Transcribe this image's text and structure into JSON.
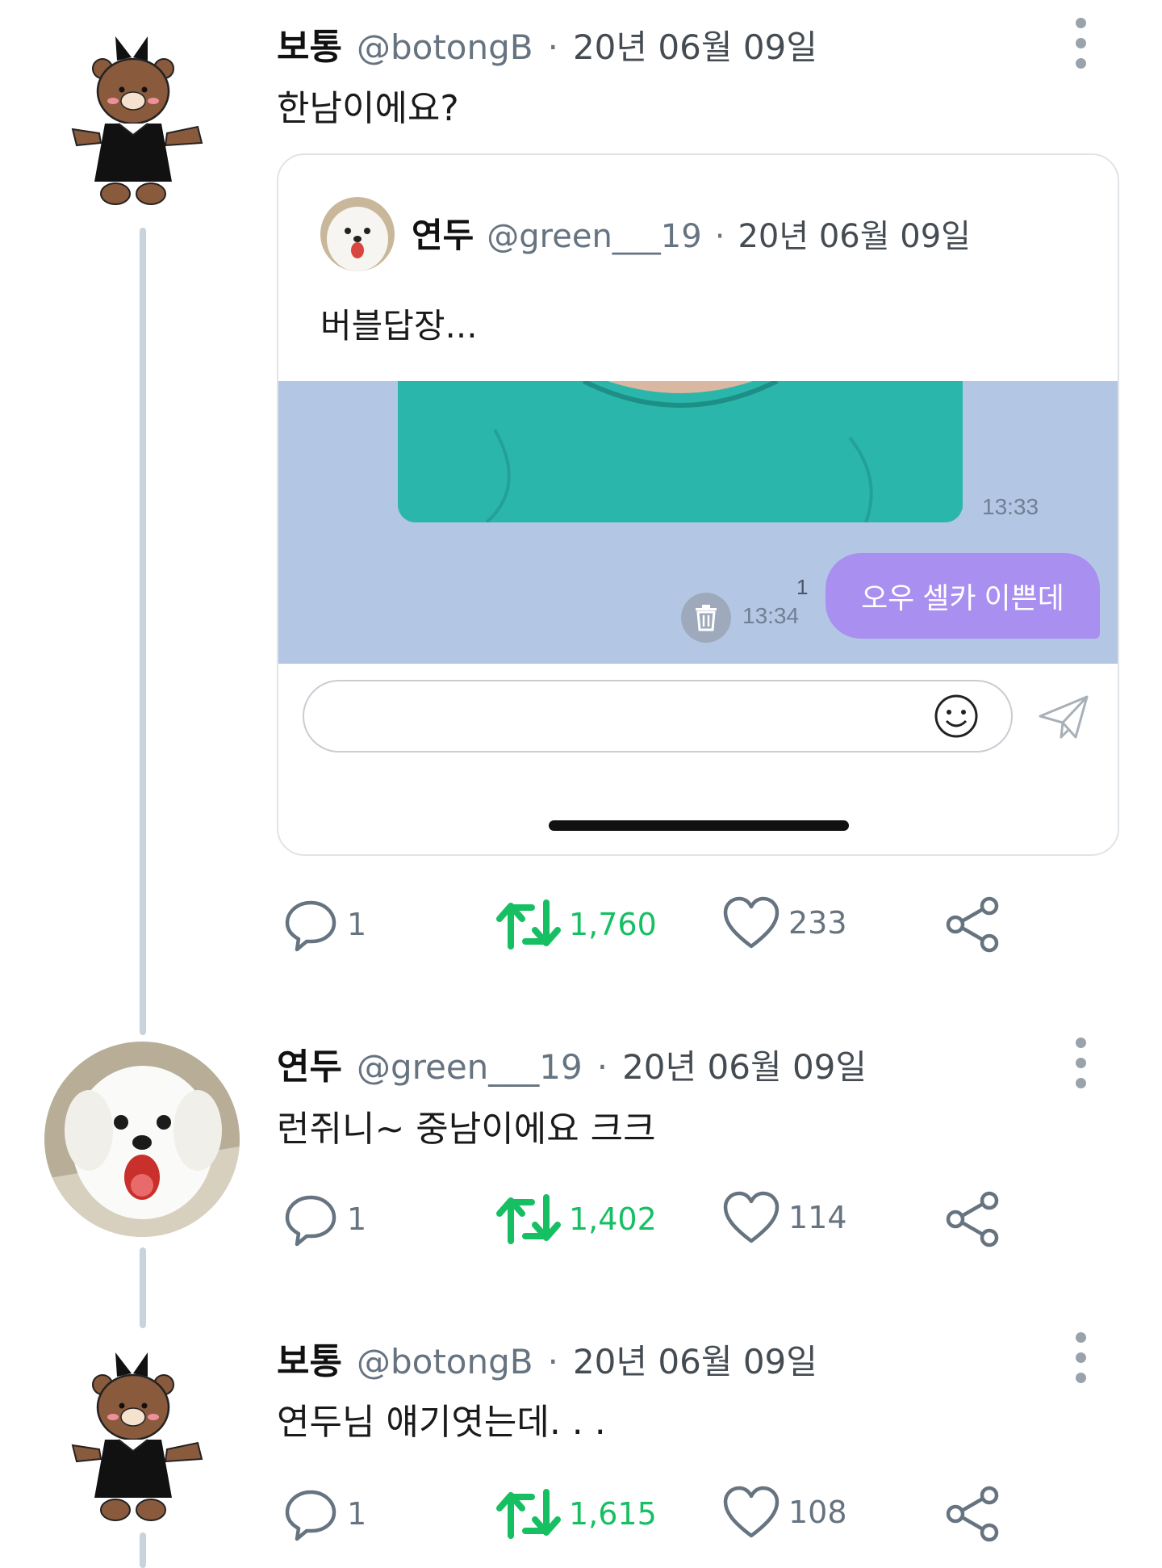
{
  "tweets": [
    {
      "name": "보통",
      "handle": "@botongB",
      "dot": "·",
      "date": "20년 06월 09일",
      "text": "한남이에요?",
      "replies": "1",
      "retweets": "1,760",
      "likes": "233"
    },
    {
      "name": "연두",
      "handle": "@green___19",
      "dot": "·",
      "date": "20년 06월 09일",
      "text": "런쥐니~ 중남이에요 크크",
      "replies": "1",
      "retweets": "1,402",
      "likes": "114"
    },
    {
      "name": "보통",
      "handle": "@botongB",
      "dot": "·",
      "date": "20년 06월 09일",
      "text": "연두님 얘기엿는데. . .",
      "replies": "1",
      "retweets": "1,615",
      "likes": "108"
    }
  ],
  "quote": {
    "name": "연두",
    "handle": "@green___19",
    "dot": "·",
    "date": "20년 06월 09일",
    "text": "버블답장...",
    "chat": {
      "photo_time": "13:33",
      "message": "오우 셀카 이쁜데",
      "unread": "1",
      "message_time": "13:34",
      "input_value": ""
    }
  },
  "icons": {
    "reply": "speech-bubble-icon",
    "retweet": "retweet-icon",
    "like": "heart-icon",
    "share": "share-icon",
    "more": "vertical-dots-icon",
    "delete": "trash-icon",
    "emoji": "smiley-icon",
    "send": "paper-plane-icon"
  },
  "colors": {
    "retweet_green": "#17bf63",
    "chat_background": "#b3c7e4",
    "bubble_purple": "#a98ff0",
    "thread_line": "#c9d3db"
  }
}
